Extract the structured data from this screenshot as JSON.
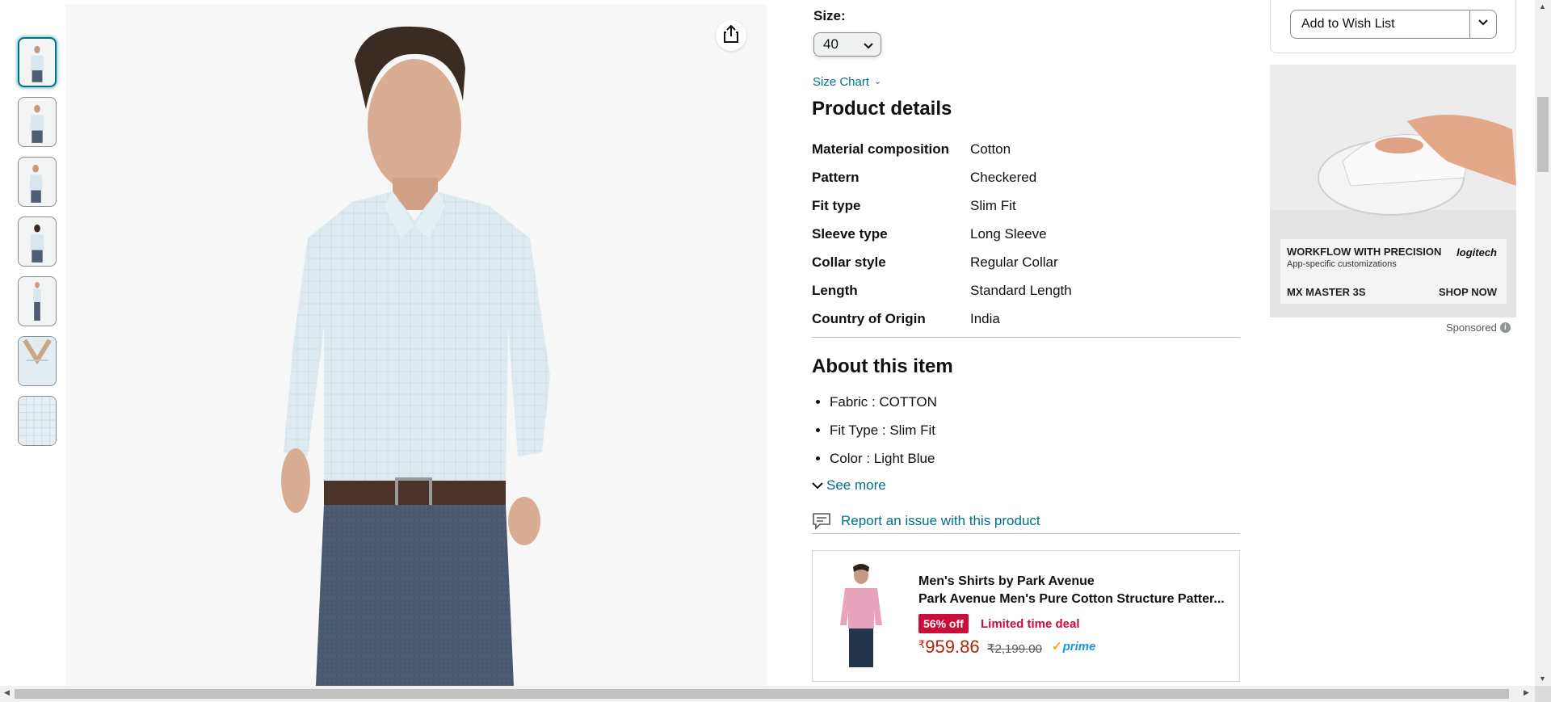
{
  "gallery": {
    "thumbnail_count": 7,
    "active_index": 0
  },
  "size": {
    "label": "Size:",
    "selected": "40",
    "size_chart_link": "Size Chart"
  },
  "product_details": {
    "title": "Product details",
    "rows": [
      {
        "key": "Material composition",
        "value": "Cotton"
      },
      {
        "key": "Pattern",
        "value": "Checkered"
      },
      {
        "key": "Fit type",
        "value": "Slim Fit"
      },
      {
        "key": "Sleeve type",
        "value": "Long Sleeve"
      },
      {
        "key": "Collar style",
        "value": "Regular Collar"
      },
      {
        "key": "Length",
        "value": "Standard Length"
      },
      {
        "key": "Country of Origin",
        "value": "India"
      }
    ]
  },
  "about": {
    "title": "About this item",
    "bullets": [
      "Fabric : COTTON",
      "Fit Type : Slim Fit",
      "Color : Light Blue"
    ],
    "see_more": "See more"
  },
  "report_link": "Report an issue with this product",
  "sponsored_product": {
    "brand_line": "Men's Shirts by Park Avenue",
    "title": "Park Avenue Men's Pure Cotton Structure Patter...",
    "discount_badge": "56% off",
    "deal_label": "Limited time deal",
    "price_symbol": "₹",
    "price": "959.86",
    "mrp": "₹2,199.00",
    "prime": "prime"
  },
  "buybox": {
    "wishlist_label": "Add to Wish List"
  },
  "ad": {
    "headline": "WORKFLOW WITH PRECISION",
    "subline": "App-specific customizations",
    "brand": "logitech",
    "product": "MX MASTER 3S",
    "cta": "SHOP NOW",
    "sponsored_label": "Sponsored"
  },
  "colors": {
    "link": "#007185",
    "deal_red": "#cc0c39",
    "price_red": "#b12704",
    "prime_blue": "#1399d6"
  }
}
